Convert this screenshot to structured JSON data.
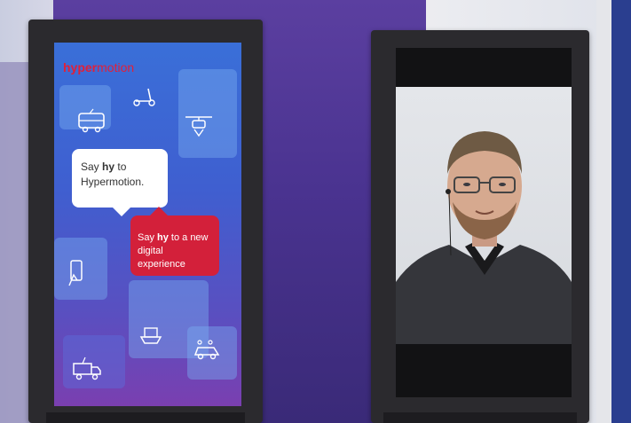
{
  "left_screen": {
    "logo_bold": "hyper",
    "logo_rest": "motion",
    "bubble_white_prefix": "Say ",
    "bubble_white_bold": "hy",
    "bubble_white_line1_rest": " to",
    "bubble_white_line2": "Hypermotion.",
    "bubble_red_prefix": "Say ",
    "bubble_red_bold": "hy",
    "bubble_red_line1_rest": " to a new",
    "bubble_red_line2": "digital experience",
    "icons": [
      "bus-icon",
      "scooter-icon",
      "drone-icon",
      "phone-icon",
      "ship-icon",
      "truck-icon",
      "car-icon"
    ]
  },
  "right_screen": {
    "content": "video-call-portrait"
  },
  "colors": {
    "brand_red": "#d3203a",
    "screen_blue": "#3a6fd8",
    "backdrop_purple": "#4a3390"
  }
}
